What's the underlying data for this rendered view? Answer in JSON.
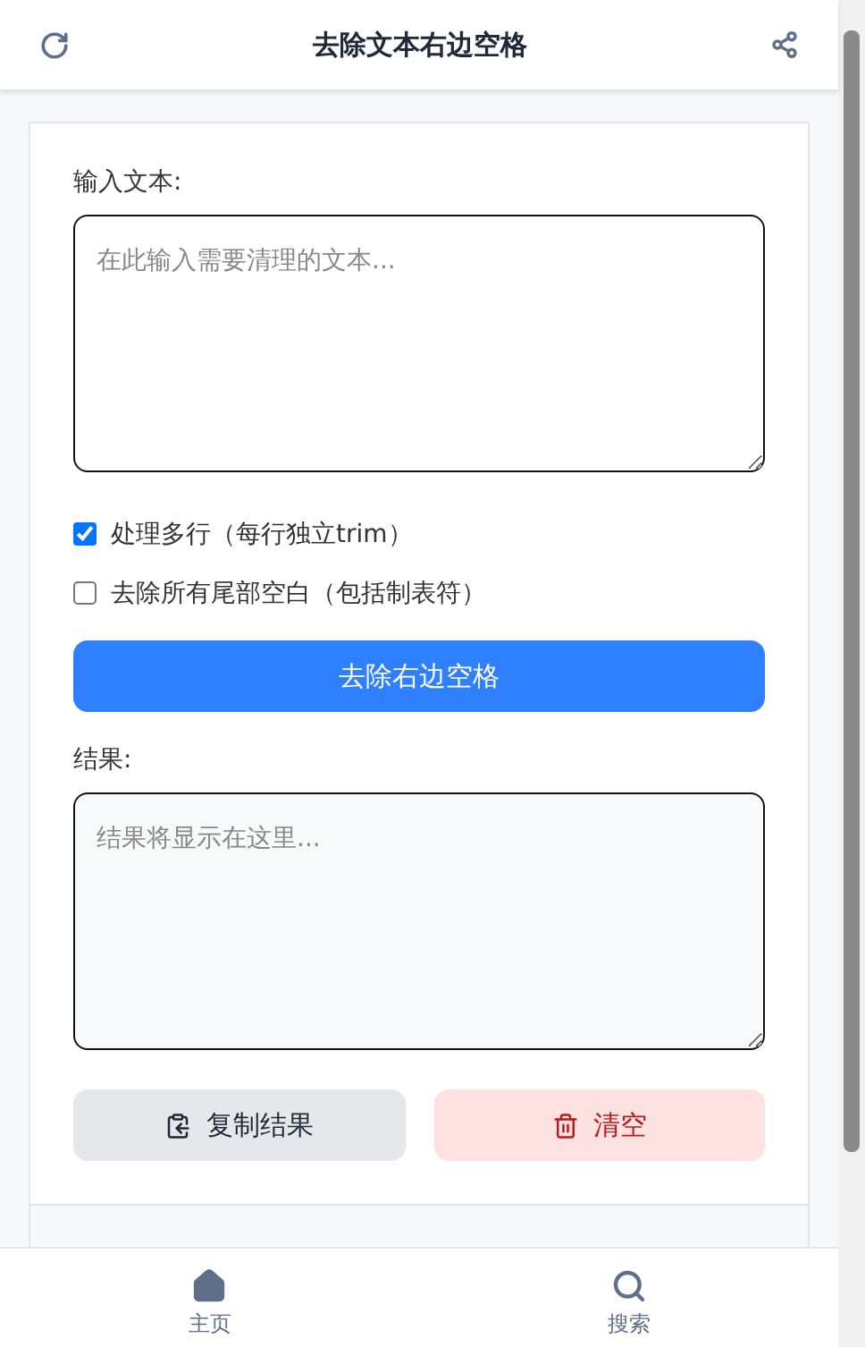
{
  "header": {
    "title": "去除文本右边空格"
  },
  "input": {
    "label": "输入文本:",
    "placeholder": "在此输入需要清理的文本..."
  },
  "options": [
    {
      "label": "处理多行（每行独立trim）",
      "checked": true
    },
    {
      "label": "去除所有尾部空白（包括制表符）",
      "checked": false
    }
  ],
  "primary_button": "去除右边空格",
  "result": {
    "label": "结果:",
    "placeholder": "结果将显示在这里..."
  },
  "actions": [
    {
      "kind": "copy",
      "label": "复制结果"
    },
    {
      "kind": "clear",
      "label": "清空"
    }
  ],
  "nav": [
    {
      "kind": "home",
      "label": "主页"
    },
    {
      "kind": "search",
      "label": "搜索"
    }
  ]
}
